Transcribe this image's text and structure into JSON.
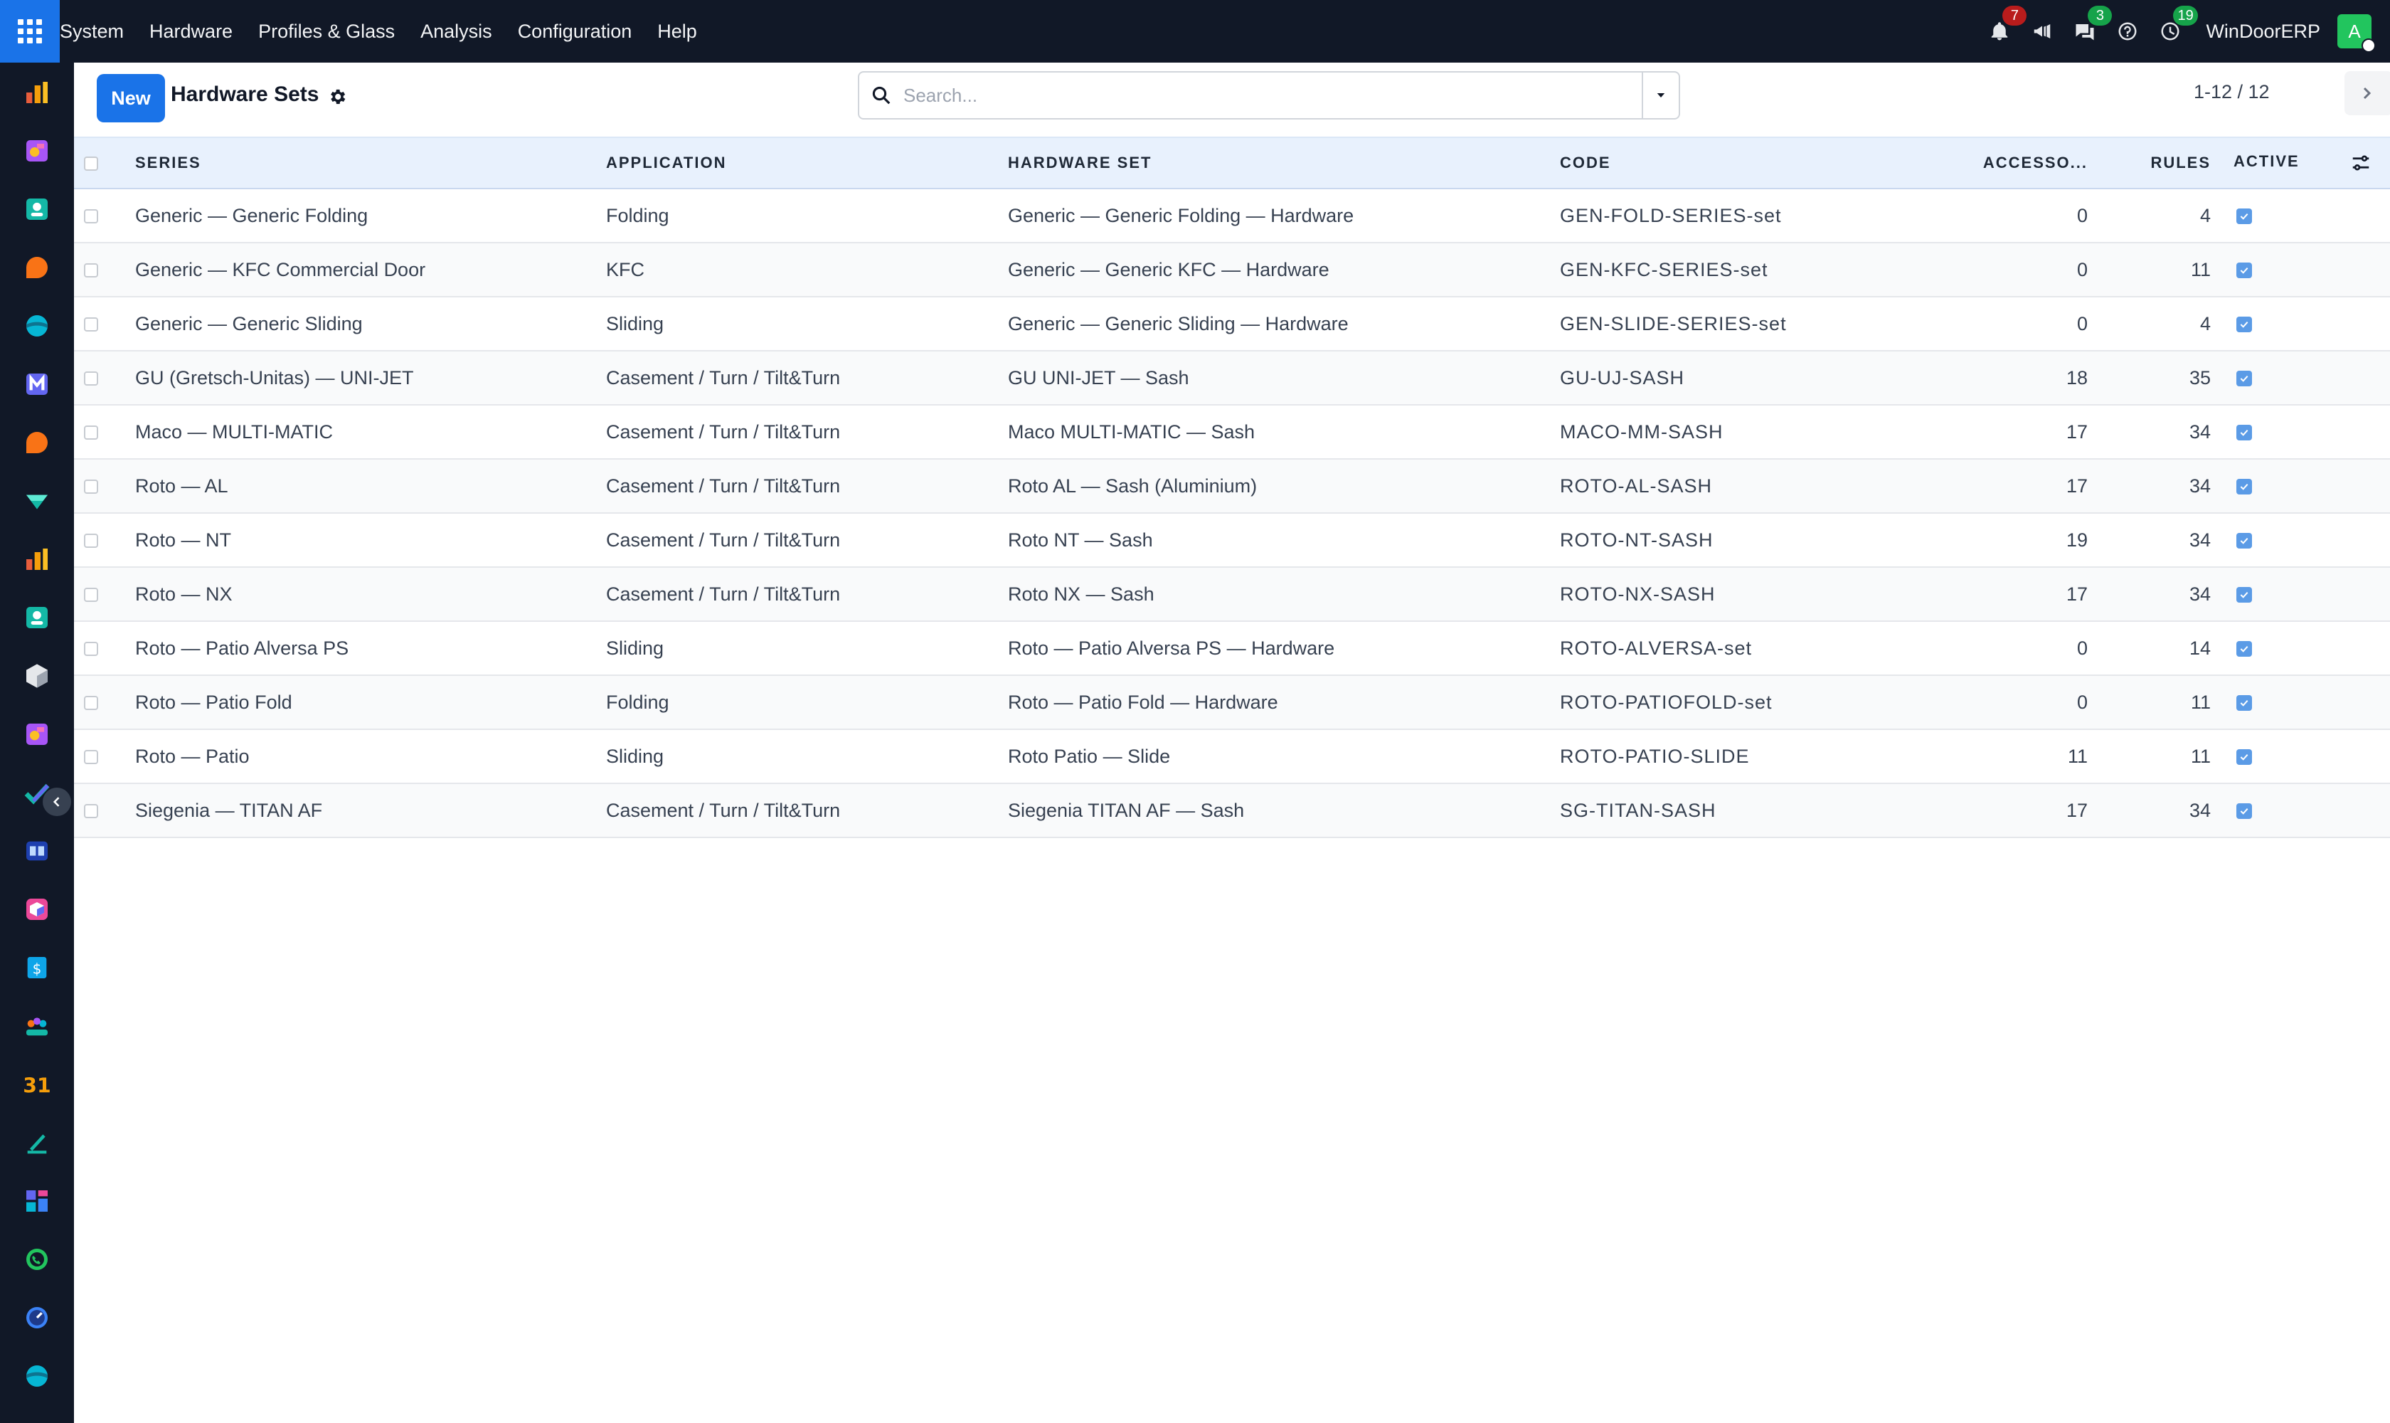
{
  "topbar": {
    "menu": [
      "System",
      "Hardware",
      "Profiles & Glass",
      "Analysis",
      "Configuration",
      "Help"
    ],
    "notifications_count": "7",
    "messages_count": "3",
    "activities_count": "19",
    "company": "WinDoorERP",
    "avatar_letter": "A"
  },
  "control": {
    "new_label": "New",
    "title": "Hardware Sets",
    "search_placeholder": "Search...",
    "pager": "1-12 / 12"
  },
  "table": {
    "columns": {
      "series": "SERIES",
      "application": "APPLICATION",
      "hardware_set": "HARDWARE SET",
      "code": "CODE",
      "accessories": "ACCESSO...",
      "rules": "RULES",
      "active": "ACTIVE"
    },
    "rows": [
      {
        "series": "Generic — Generic Folding",
        "application": "Folding",
        "hardware_set": "Generic — Generic Folding — Hardware",
        "code": "GEN-FOLD-SERIES-set",
        "accessories": "0",
        "rules": "4"
      },
      {
        "series": "Generic — KFC Commercial Door",
        "application": "KFC",
        "hardware_set": "Generic — Generic KFC — Hardware",
        "code": "GEN-KFC-SERIES-set",
        "accessories": "0",
        "rules": "11"
      },
      {
        "series": "Generic — Generic Sliding",
        "application": "Sliding",
        "hardware_set": "Generic — Generic Sliding — Hardware",
        "code": "GEN-SLIDE-SERIES-set",
        "accessories": "0",
        "rules": "4"
      },
      {
        "series": "GU (Gretsch-Unitas) — UNI-JET",
        "application": "Casement / Turn / Tilt&Turn",
        "hardware_set": "GU UNI-JET — Sash",
        "code": "GU-UJ-SASH",
        "accessories": "18",
        "rules": "35"
      },
      {
        "series": "Maco — MULTI-MATIC",
        "application": "Casement / Turn / Tilt&Turn",
        "hardware_set": "Maco MULTI-MATIC — Sash",
        "code": "MACO-MM-SASH",
        "accessories": "17",
        "rules": "34"
      },
      {
        "series": "Roto — AL",
        "application": "Casement / Turn / Tilt&Turn",
        "hardware_set": "Roto AL — Sash (Aluminium)",
        "code": "ROTO-AL-SASH",
        "accessories": "17",
        "rules": "34"
      },
      {
        "series": "Roto — NT",
        "application": "Casement / Turn / Tilt&Turn",
        "hardware_set": "Roto NT — Sash",
        "code": "ROTO-NT-SASH",
        "accessories": "19",
        "rules": "34"
      },
      {
        "series": "Roto — NX",
        "application": "Casement / Turn / Tilt&Turn",
        "hardware_set": "Roto NX — Sash",
        "code": "ROTO-NX-SASH",
        "accessories": "17",
        "rules": "34"
      },
      {
        "series": "Roto — Patio Alversa PS",
        "application": "Sliding",
        "hardware_set": "Roto — Patio Alversa PS — Hardware",
        "code": "ROTO-ALVERSA-set",
        "accessories": "0",
        "rules": "14"
      },
      {
        "series": "Roto — Patio Fold",
        "application": "Folding",
        "hardware_set": "Roto — Patio Fold — Hardware",
        "code": "ROTO-PATIOFOLD-set",
        "accessories": "0",
        "rules": "11"
      },
      {
        "series": "Roto — Patio",
        "application": "Sliding",
        "hardware_set": "Roto Patio — Slide",
        "code": "ROTO-PATIO-SLIDE",
        "accessories": "11",
        "rules": "11"
      },
      {
        "series": "Siegenia — TITAN AF",
        "application": "Casement / Turn / Tilt&Turn",
        "hardware_set": "Siegenia TITAN AF — Sash",
        "code": "SG-TITAN-SASH",
        "accessories": "17",
        "rules": "34"
      }
    ]
  },
  "sidebar": {
    "apps": [
      "dashboard-app-icon",
      "hardware-app-icon",
      "contacts-app-icon",
      "discuss-app-icon",
      "website-app-icon",
      "mail-app-icon",
      "discuss-app-icon",
      "sign-app-icon",
      "reporting-app-icon",
      "employees-app-icon",
      "inventory-app-icon",
      "configurator-app-icon",
      "project-app-icon",
      "knowledge-app-icon",
      "products-app-icon",
      "invoicing-app-icon",
      "team-app-icon",
      "calendar-app-icon",
      "sign-pen-app-icon",
      "dashboards-app-icon",
      "whatsapp-app-icon",
      "timer-app-icon",
      "website-app-icon"
    ]
  }
}
